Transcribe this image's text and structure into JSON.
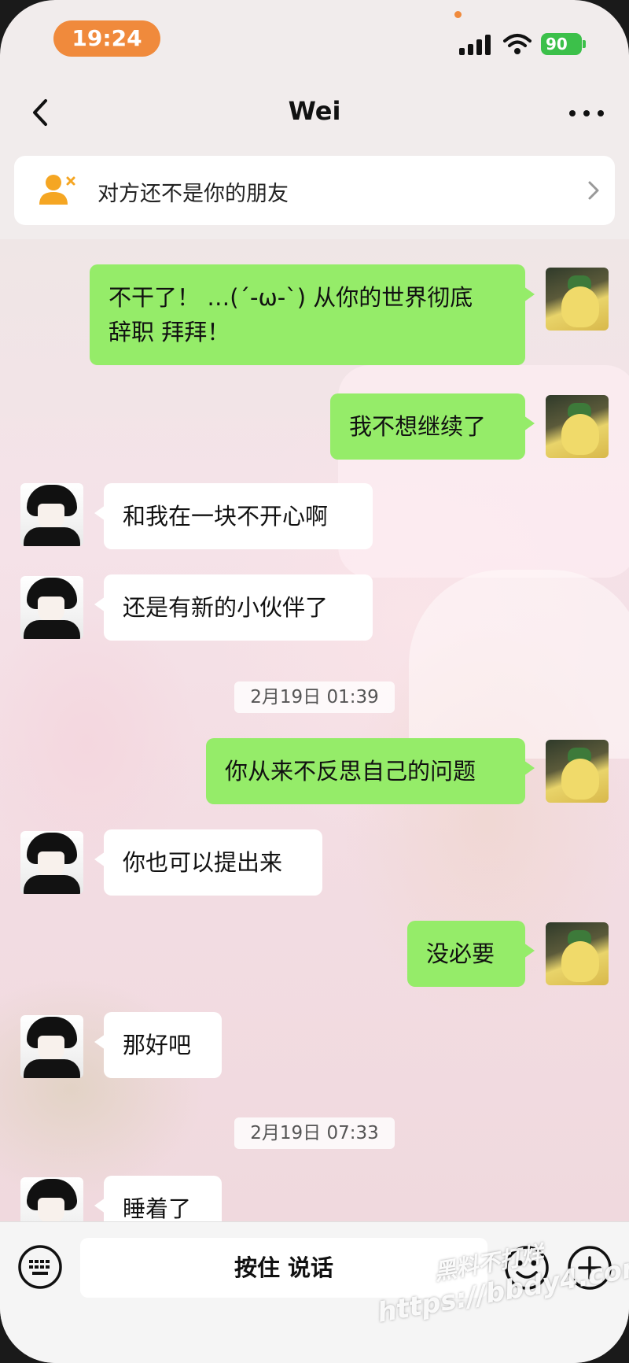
{
  "status_bar": {
    "time": "19:24",
    "battery": "90"
  },
  "nav": {
    "title": "Wei",
    "back_icon": "chevron-left-icon",
    "more_icon": "ellipsis-icon"
  },
  "friend_banner": {
    "text": "对方还不是你的朋友",
    "icon": "person-x-icon"
  },
  "messages": [
    {
      "sender": "self",
      "lines": [
        "不干了！ …(´-ω-`) 从你的世界彻底",
        "辞职 拜拜！"
      ]
    },
    {
      "sender": "self",
      "lines": [
        "我不想继续了"
      ]
    },
    {
      "sender": "other",
      "lines": [
        "和我在一块不开心啊"
      ]
    },
    {
      "sender": "other",
      "lines": [
        "还是有新的小伙伴了"
      ]
    },
    {
      "type": "timestamp",
      "text": "2月19日 01:39"
    },
    {
      "sender": "self",
      "lines": [
        "你从来不反思自己的问题"
      ]
    },
    {
      "sender": "other",
      "lines": [
        "你也可以提出来"
      ]
    },
    {
      "sender": "self",
      "lines": [
        "没必要"
      ]
    },
    {
      "sender": "other",
      "lines": [
        "那好吧"
      ]
    },
    {
      "type": "timestamp",
      "text": "2月19日 07:33"
    },
    {
      "sender": "other",
      "lines": [
        "睡着了"
      ]
    }
  ],
  "input_bar": {
    "hold_to_talk": "按住 说话",
    "left_icon": "keyboard-icon",
    "emoji_icon": "smiley-icon",
    "plus_icon": "plus-circle-icon"
  },
  "watermark": {
    "line1": "黑料不打烊",
    "line2": "https://bbdy4.com"
  },
  "colors": {
    "self_bubble": "#95ec69",
    "other_bubble": "#ffffff",
    "time_pill": "#f08a3c",
    "battery": "#3cc04a"
  }
}
